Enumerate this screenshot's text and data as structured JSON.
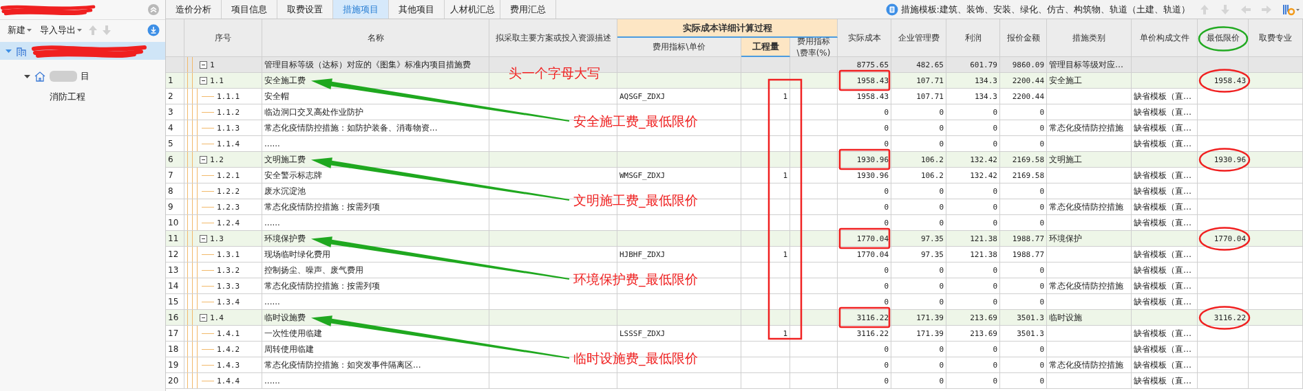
{
  "sidebar": {
    "title_redacted": true,
    "toolbar": [
      {
        "label": "新建",
        "dropdown": true
      },
      {
        "label": "导入导出",
        "dropdown": true
      }
    ],
    "tree": [
      {
        "redacted": true,
        "selected": true,
        "expanded": true,
        "children": [
          {
            "label": "目",
            "blurred": true,
            "selected": false,
            "expanded": true,
            "children": [
              {
                "label": "消防工程",
                "selected": false
              }
            ]
          }
        ]
      }
    ]
  },
  "tabs": [
    {
      "label": "造价分析",
      "selected": false
    },
    {
      "label": "项目信息",
      "selected": false
    },
    {
      "label": "取费设置",
      "selected": false
    },
    {
      "label": "措施项目",
      "selected": true
    },
    {
      "label": "其他项目",
      "selected": false
    },
    {
      "label": "人材机汇总",
      "selected": false
    },
    {
      "label": "费用汇总",
      "selected": false
    }
  ],
  "template": "措施模板:建筑、装饰、安装、绿化、仿古、构筑物、轨道（土建、轨道）",
  "table": {
    "columns": [
      {
        "label": "序号"
      },
      {
        "label": "名称"
      },
      {
        "label": "拟采取主要方案或投入资源描述"
      },
      {
        "label": "实际成本详细计算过程",
        "children": [
          {
            "label": "费用指标\\单价",
            "selected": false
          },
          {
            "label": "工程量",
            "selected": true
          },
          {
            "label": "费用指标\\费率(%)",
            "selected": false
          }
        ]
      },
      {
        "label": "实际成本"
      },
      {
        "label": "企业管理费"
      },
      {
        "label": "利润"
      },
      {
        "label": "报价金额"
      },
      {
        "label": "措施类别"
      },
      {
        "label": "单价构成文件"
      },
      {
        "label": "最低限价",
        "circled": true
      },
      {
        "label": "取费专业"
      }
    ],
    "rows": [
      {
        "code": "1",
        "name": "管理目标等级（达标）对应的《图集》标准内项目措施费",
        "actual_cost": "8775.65",
        "management_fee": "482.65",
        "profit": "601.79",
        "quote_amount": "9860.09",
        "category": "管理目标等级对应…",
        "expanded": true,
        "children": [
          {
            "no": "1",
            "code": "1.1",
            "name": "安全施工费",
            "actual_cost": "1958.43",
            "management_fee": "107.71",
            "profit": "134.3",
            "quote_amount": "2200.44",
            "category": "安全施工",
            "min_price": "1958.43",
            "expanded": true,
            "cost_boxed": true,
            "min_circled": true,
            "qty_box_start": true,
            "note": "头一个字母大写",
            "callout": "安全施工费_最低限价",
            "children": [
              {
                "no": "2",
                "code": "1.1.1",
                "name": "安全帽",
                "unit_index": "AQSGF_ZDXJ",
                "quantity": "1",
                "actual_cost": "1958.43",
                "management_fee": "107.71",
                "profit": "134.3",
                "quote_amount": "2200.44",
                "unit_price_file": "缺省模板（直…"
              },
              {
                "no": "3",
                "code": "1.1.2",
                "name": "临边洞口交叉高处作业防护",
                "actual_cost": "0",
                "management_fee": "0",
                "profit": "0",
                "quote_amount": "0",
                "unit_price_file": "缺省模板（直…"
              },
              {
                "no": "4",
                "code": "1.1.3",
                "name": "常态化疫情防控措施：如防护装备、消毒物资...",
                "actual_cost": "0",
                "management_fee": "0",
                "profit": "0",
                "quote_amount": "0",
                "category": "常态化疫情防控措施",
                "unit_price_file": "缺省模板（直…"
              },
              {
                "no": "5",
                "code": "1.1.4",
                "name": "......",
                "actual_cost": "0",
                "management_fee": "0",
                "profit": "0",
                "quote_amount": "0",
                "unit_price_file": "缺省模板（直…"
              }
            ]
          },
          {
            "no": "6",
            "code": "1.2",
            "name": "文明施工费",
            "actual_cost": "1930.96",
            "management_fee": "106.2",
            "profit": "132.42",
            "quote_amount": "2169.58",
            "category": "文明施工",
            "min_price": "1930.96",
            "expanded": true,
            "cost_boxed": true,
            "min_circled": true,
            "callout": "文明施工费_最低限价",
            "children": [
              {
                "no": "7",
                "code": "1.2.1",
                "name": "安全警示标志牌",
                "unit_index": "WMSGF_ZDXJ",
                "quantity": "1",
                "actual_cost": "1930.96",
                "management_fee": "106.2",
                "profit": "132.42",
                "quote_amount": "2169.58",
                "unit_price_file": "缺省模板（直…"
              },
              {
                "no": "8",
                "code": "1.2.2",
                "name": "废水沉淀池",
                "actual_cost": "0",
                "management_fee": "0",
                "profit": "0",
                "quote_amount": "0",
                "unit_price_file": "缺省模板（直…"
              },
              {
                "no": "9",
                "code": "1.2.3",
                "name": "常态化疫情防控措施：按需列项",
                "actual_cost": "0",
                "management_fee": "0",
                "profit": "0",
                "quote_amount": "0",
                "category": "常态化疫情防控措施",
                "unit_price_file": "缺省模板（直…"
              },
              {
                "no": "10",
                "code": "1.2.4",
                "name": "......",
                "actual_cost": "0",
                "management_fee": "0",
                "profit": "0",
                "quote_amount": "0",
                "unit_price_file": "缺省模板（直…"
              }
            ]
          },
          {
            "no": "11",
            "code": "1.3",
            "name": "环境保护费",
            "actual_cost": "1770.04",
            "management_fee": "97.35",
            "profit": "121.38",
            "quote_amount": "1988.77",
            "category": "环境保护",
            "min_price": "1770.04",
            "expanded": true,
            "cost_boxed": true,
            "min_circled": true,
            "callout": "环境保护费_最低限价",
            "children": [
              {
                "no": "12",
                "code": "1.3.1",
                "name": "现场临时绿化费用",
                "unit_index": "HJBHF_ZDXJ",
                "quantity": "1",
                "actual_cost": "1770.04",
                "management_fee": "97.35",
                "profit": "121.38",
                "quote_amount": "1988.77",
                "unit_price_file": "缺省模板（直…"
              },
              {
                "no": "13",
                "code": "1.3.2",
                "name": "控制扬尘、噪声、废气费用",
                "actual_cost": "0",
                "management_fee": "0",
                "profit": "0",
                "quote_amount": "0",
                "unit_price_file": "缺省模板（直…"
              },
              {
                "no": "14",
                "code": "1.3.3",
                "name": "常态化疫情防控措施：按需列项",
                "actual_cost": "0",
                "management_fee": "0",
                "profit": "0",
                "quote_amount": "0",
                "category": "常态化疫情防控措施",
                "unit_price_file": "缺省模板（直…"
              },
              {
                "no": "15",
                "code": "1.3.4",
                "name": "......",
                "actual_cost": "0",
                "management_fee": "0",
                "profit": "0",
                "quote_amount": "0",
                "unit_price_file": "缺省模板（直…"
              }
            ]
          },
          {
            "no": "16",
            "code": "1.4",
            "name": "临时设施费",
            "actual_cost": "3116.22",
            "management_fee": "171.39",
            "profit": "213.69",
            "quote_amount": "3501.3",
            "category": "临时设施",
            "min_price": "3116.22",
            "expanded": true,
            "cost_boxed": true,
            "min_circled": true,
            "callout": "临时设施费_最低限价",
            "children": [
              {
                "no": "17",
                "code": "1.4.1",
                "name": "一次性使用临建",
                "qty_box_end": true,
                "unit_index": "LSSSF_ZDXJ",
                "quantity": "1",
                "actual_cost": "3116.22",
                "management_fee": "171.39",
                "profit": "213.69",
                "quote_amount": "3501.3",
                "unit_price_file": "缺省模板（直…"
              },
              {
                "no": "18",
                "code": "1.4.2",
                "name": "周转使用临建",
                "actual_cost": "0",
                "management_fee": "0",
                "profit": "0",
                "quote_amount": "0",
                "unit_price_file": "缺省模板（直…"
              },
              {
                "no": "19",
                "code": "1.4.3",
                "name": "常态化疫情防控措施：如突发事件隔离区...",
                "actual_cost": "0",
                "management_fee": "0",
                "profit": "0",
                "quote_amount": "0",
                "category": "常态化疫情防控措施",
                "unit_price_file": "缺省模板（直…"
              },
              {
                "no": "20",
                "code": "1.4.4",
                "name": "......",
                "actual_cost": "0",
                "management_fee": "0",
                "profit": "0",
                "quote_amount": "0",
                "unit_price_file": "缺省模板（直…"
              }
            ]
          }
        ]
      }
    ],
    "qty_box": true
  }
}
